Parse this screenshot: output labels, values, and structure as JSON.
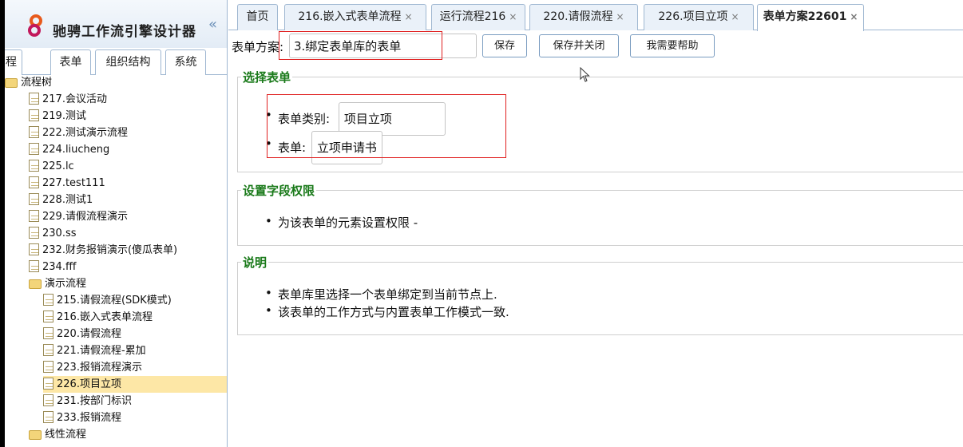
{
  "app": {
    "title": "驰骋工作流引擎设计器"
  },
  "sidebar": {
    "tabs": [
      "程",
      "表单",
      "组织结构",
      "系统"
    ],
    "tree": [
      {
        "label": "流程树",
        "type": "folder",
        "level": 0
      },
      {
        "label": "217.会议活动",
        "type": "file",
        "level": 1
      },
      {
        "label": "219.测试",
        "type": "file",
        "level": 1
      },
      {
        "label": "222.测试演示流程",
        "type": "file",
        "level": 1
      },
      {
        "label": "224.liucheng",
        "type": "file",
        "level": 1
      },
      {
        "label": "225.lc",
        "type": "file",
        "level": 1
      },
      {
        "label": "227.test111",
        "type": "file",
        "level": 1
      },
      {
        "label": "228.测试1",
        "type": "file",
        "level": 1
      },
      {
        "label": "229.请假流程演示",
        "type": "file",
        "level": 1
      },
      {
        "label": "230.ss",
        "type": "file",
        "level": 1
      },
      {
        "label": "232.财务报销演示(傻瓜表单)",
        "type": "file",
        "level": 1
      },
      {
        "label": "234.fff",
        "type": "file",
        "level": 1
      },
      {
        "label": "演示流程",
        "type": "folder",
        "level": 1
      },
      {
        "label": "215.请假流程(SDK模式)",
        "type": "file",
        "level": 2
      },
      {
        "label": "216.嵌入式表单流程",
        "type": "file",
        "level": 2
      },
      {
        "label": "220.请假流程",
        "type": "file",
        "level": 2
      },
      {
        "label": "221.请假流程-累加",
        "type": "file",
        "level": 2
      },
      {
        "label": "223.报销流程演示",
        "type": "file",
        "level": 2
      },
      {
        "label": "226.项目立项",
        "type": "file",
        "level": 2,
        "selected": true
      },
      {
        "label": "231.按部门标识",
        "type": "file",
        "level": 2
      },
      {
        "label": "233.报销流程",
        "type": "file",
        "level": 2
      },
      {
        "label": "线性流程",
        "type": "folder",
        "level": 1
      }
    ]
  },
  "tabs": [
    {
      "label": "首页",
      "closable": false
    },
    {
      "label": "216.嵌入式表单流程",
      "closable": true
    },
    {
      "label": "运行流程216",
      "closable": true
    },
    {
      "label": "220.请假流程",
      "closable": true
    },
    {
      "label": "226.项目立项",
      "closable": true
    },
    {
      "label": "表单方案22601",
      "closable": true,
      "active": true
    }
  ],
  "close_glyph": "×",
  "form": {
    "label": "表单方案:",
    "value": "3.绑定表单库的表单",
    "save": "保存",
    "save_close": "保存并关闭",
    "help": "我需要帮助"
  },
  "section_select": {
    "title": "选择表单",
    "category_label": "表单类别:",
    "category_value": "项目立项",
    "form_label": "表单:",
    "form_value": "立项申请书"
  },
  "section_perm": {
    "title": "设置字段权限",
    "item": "为该表单的元素设置权限 -"
  },
  "section_note": {
    "title": "说明",
    "items": [
      "表单库里选择一个表单绑定到当前节点上.",
      "该表单的工作方式与内置表单工作模式一致."
    ]
  },
  "colors": {
    "legend": "#1a7a1a",
    "highlight": "#e02020",
    "selected_row": "#fde7a6",
    "border": "#9fb7d1"
  }
}
